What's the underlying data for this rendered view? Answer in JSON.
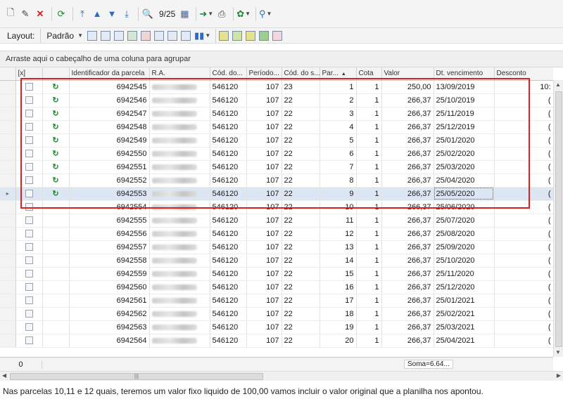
{
  "toolbar1": {
    "record_counter": "9/25"
  },
  "toolbar2": {
    "layout_label": "Layout:",
    "layout_value": "Padrão"
  },
  "groupbar": {
    "text": "Arraste aqui o cabeçalho de uma coluna para agrupar"
  },
  "grid": {
    "columns": [
      "[x]",
      "",
      "Identificador da parcela",
      "R.A.",
      "Cód. do...",
      "Período...",
      "Cód. do s...",
      "Par...",
      "Cota",
      "Valor",
      "Dt. vencimento",
      "Desconto"
    ],
    "rows": [
      {
        "id": "6942545",
        "cod": "546120",
        "periodo": "107",
        "cods": "23",
        "par": "1",
        "cota": "1",
        "valor": "250,00",
        "dt": "13/09/2019",
        "desc": "10:",
        "status": "ok"
      },
      {
        "id": "6942546",
        "cod": "546120",
        "periodo": "107",
        "cods": "22",
        "par": "2",
        "cota": "1",
        "valor": "266,37",
        "dt": "25/10/2019",
        "desc": "(",
        "status": "ok"
      },
      {
        "id": "6942547",
        "cod": "546120",
        "periodo": "107",
        "cods": "22",
        "par": "3",
        "cota": "1",
        "valor": "266,37",
        "dt": "25/11/2019",
        "desc": "(",
        "status": "ok"
      },
      {
        "id": "6942548",
        "cod": "546120",
        "periodo": "107",
        "cods": "22",
        "par": "4",
        "cota": "1",
        "valor": "266,37",
        "dt": "25/12/2019",
        "desc": "(",
        "status": "ok"
      },
      {
        "id": "6942549",
        "cod": "546120",
        "periodo": "107",
        "cods": "22",
        "par": "5",
        "cota": "1",
        "valor": "266,37",
        "dt": "25/01/2020",
        "desc": "(",
        "status": "ok"
      },
      {
        "id": "6942550",
        "cod": "546120",
        "periodo": "107",
        "cods": "22",
        "par": "6",
        "cota": "1",
        "valor": "266,37",
        "dt": "25/02/2020",
        "desc": "(",
        "status": "ok"
      },
      {
        "id": "6942551",
        "cod": "546120",
        "periodo": "107",
        "cods": "22",
        "par": "7",
        "cota": "1",
        "valor": "266,37",
        "dt": "25/03/2020",
        "desc": "(",
        "status": "ok"
      },
      {
        "id": "6942552",
        "cod": "546120",
        "periodo": "107",
        "cods": "22",
        "par": "8",
        "cota": "1",
        "valor": "266,37",
        "dt": "25/04/2020",
        "desc": "(",
        "status": "ok"
      },
      {
        "id": "6942553",
        "cod": "546120",
        "periodo": "107",
        "cods": "22",
        "par": "9",
        "cota": "1",
        "valor": "266,37",
        "dt": "25/05/2020",
        "desc": "(",
        "status": "ok"
      },
      {
        "id": "6942554",
        "cod": "546120",
        "periodo": "107",
        "cods": "22",
        "par": "10",
        "cota": "1",
        "valor": "266,37",
        "dt": "25/06/2020",
        "desc": "(",
        "status": ""
      },
      {
        "id": "6942555",
        "cod": "546120",
        "periodo": "107",
        "cods": "22",
        "par": "11",
        "cota": "1",
        "valor": "266,37",
        "dt": "25/07/2020",
        "desc": "(",
        "status": ""
      },
      {
        "id": "6942556",
        "cod": "546120",
        "periodo": "107",
        "cods": "22",
        "par": "12",
        "cota": "1",
        "valor": "266,37",
        "dt": "25/08/2020",
        "desc": "(",
        "status": ""
      },
      {
        "id": "6942557",
        "cod": "546120",
        "periodo": "107",
        "cods": "22",
        "par": "13",
        "cota": "1",
        "valor": "266,37",
        "dt": "25/09/2020",
        "desc": "(",
        "status": ""
      },
      {
        "id": "6942558",
        "cod": "546120",
        "periodo": "107",
        "cods": "22",
        "par": "14",
        "cota": "1",
        "valor": "266,37",
        "dt": "25/10/2020",
        "desc": "(",
        "status": ""
      },
      {
        "id": "6942559",
        "cod": "546120",
        "periodo": "107",
        "cods": "22",
        "par": "15",
        "cota": "1",
        "valor": "266,37",
        "dt": "25/11/2020",
        "desc": "(",
        "status": ""
      },
      {
        "id": "6942560",
        "cod": "546120",
        "periodo": "107",
        "cods": "22",
        "par": "16",
        "cota": "1",
        "valor": "266,37",
        "dt": "25/12/2020",
        "desc": "(",
        "status": ""
      },
      {
        "id": "6942561",
        "cod": "546120",
        "periodo": "107",
        "cods": "22",
        "par": "17",
        "cota": "1",
        "valor": "266,37",
        "dt": "25/01/2021",
        "desc": "(",
        "status": ""
      },
      {
        "id": "6942562",
        "cod": "546120",
        "periodo": "107",
        "cods": "22",
        "par": "18",
        "cota": "1",
        "valor": "266,37",
        "dt": "25/02/2021",
        "desc": "(",
        "status": ""
      },
      {
        "id": "6942563",
        "cod": "546120",
        "periodo": "107",
        "cods": "22",
        "par": "19",
        "cota": "1",
        "valor": "266,37",
        "dt": "25/03/2021",
        "desc": "(",
        "status": ""
      },
      {
        "id": "6942564",
        "cod": "546120",
        "periodo": "107",
        "cods": "22",
        "par": "20",
        "cota": "1",
        "valor": "266,37",
        "dt": "25/04/2021",
        "desc": "(",
        "status": ""
      }
    ]
  },
  "footer": {
    "checked_count": "0",
    "sum": "Soma=6.64..."
  },
  "caption": "Nas parcelas 10,11 e 12 quais, teremos um valor fixo liquido de 100,00 vamos incluir o valor original que a planilha nos apontou."
}
